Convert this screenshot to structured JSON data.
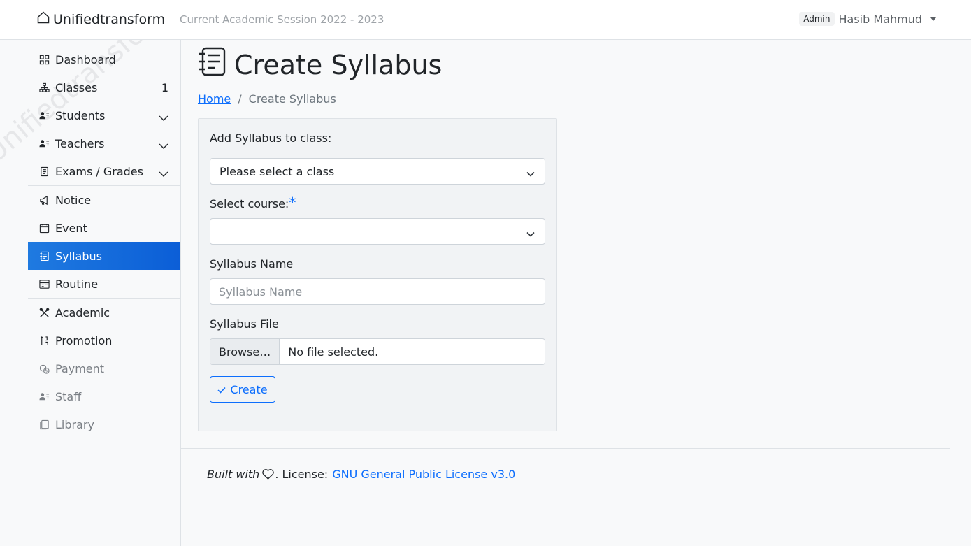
{
  "header": {
    "brand": "Unifiedtransform",
    "session": "Current Academic Session 2022 - 2023",
    "role_badge": "Admin",
    "user_name": "Hasib Mahmud"
  },
  "sidebar": {
    "watermark": "Unifiedtransform",
    "items": [
      {
        "label": "Dashboard",
        "icon": "grid-icon"
      },
      {
        "label": "Classes",
        "icon": "diagram-icon",
        "count": "1"
      },
      {
        "label": "Students",
        "icon": "person-lines-icon"
      },
      {
        "label": "Teachers",
        "icon": "person-lines-icon"
      },
      {
        "label": "Exams / Grades",
        "icon": "file-text-icon"
      },
      {
        "label": "Notice",
        "icon": "megaphone-icon"
      },
      {
        "label": "Event",
        "icon": "calendar-icon"
      },
      {
        "label": "Syllabus",
        "icon": "journal-text-icon",
        "active": true
      },
      {
        "label": "Routine",
        "icon": "calendar-table-icon"
      },
      {
        "label": "Academic",
        "icon": "tools-icon"
      },
      {
        "label": "Promotion",
        "icon": "sort-numeric-icon"
      },
      {
        "label": "Payment",
        "icon": "cash-coin-icon",
        "muted": true
      },
      {
        "label": "Staff",
        "icon": "person-lines-icon",
        "muted": true
      },
      {
        "label": "Library",
        "icon": "journals-icon",
        "muted": true
      }
    ]
  },
  "main": {
    "title": "Create Syllabus",
    "breadcrumb_home": "Home",
    "breadcrumb_current": "Create Syllabus",
    "form": {
      "class_label": "Add Syllabus to class:",
      "class_selected": "Please select a class",
      "course_label": "Select course:",
      "course_required": "*",
      "course_selected": "",
      "name_label": "Syllabus Name",
      "name_placeholder": "Syllabus Name",
      "file_label": "Syllabus File",
      "file_browse": "Browse…",
      "file_status": "No file selected.",
      "create_label": "Create"
    }
  },
  "footer": {
    "built_with": "Built with",
    "license_prefix": ". License:",
    "license_link": "GNU General Public License v3.0"
  },
  "colors": {
    "accent": "#0d6efd",
    "active_gradient_start": "#1f7ae0",
    "active_gradient_end": "#0b5ed7"
  }
}
